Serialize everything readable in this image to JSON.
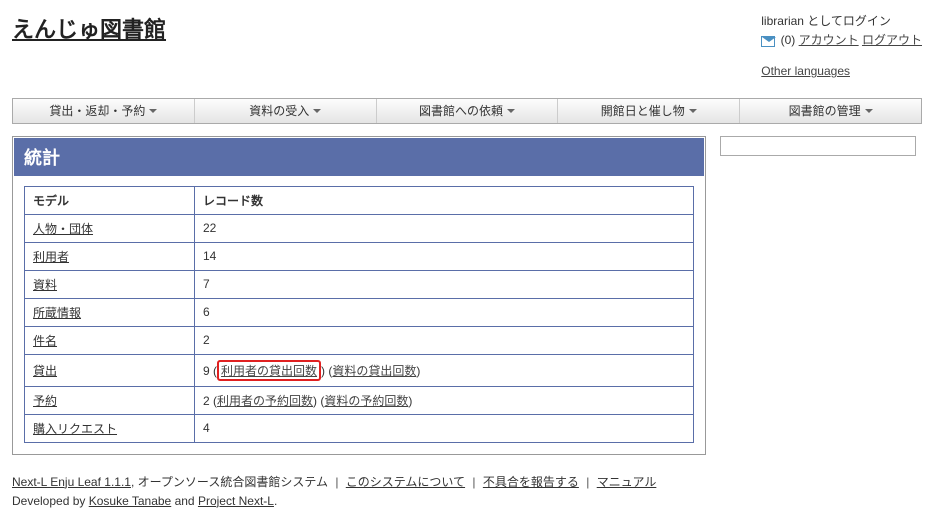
{
  "site": {
    "title": "えんじゅ図書館"
  },
  "login": {
    "status": "librarian としてログイン",
    "count": "(0)",
    "account": "アカウント",
    "logout": "ログアウト",
    "other_languages": "Other languages"
  },
  "menu": {
    "items": [
      {
        "label": "貸出・返却・予約"
      },
      {
        "label": "資料の受入"
      },
      {
        "label": "図書館への依頼"
      },
      {
        "label": "開館日と催し物"
      },
      {
        "label": "図書館の管理"
      }
    ]
  },
  "panel": {
    "title": "統計",
    "headers": {
      "model": "モデル",
      "records": "レコード数"
    },
    "rows": [
      {
        "label": "人物・団体",
        "value": "22",
        "links": []
      },
      {
        "label": "利用者",
        "value": "14",
        "links": []
      },
      {
        "label": "資料",
        "value": "7",
        "links": []
      },
      {
        "label": "所蔵情報",
        "value": "6",
        "links": []
      },
      {
        "label": "件名",
        "value": "2",
        "links": []
      },
      {
        "label": "貸出",
        "value": "9",
        "links": [
          "利用者の貸出回数",
          "資料の貸出回数"
        ],
        "highlight": 0
      },
      {
        "label": "予約",
        "value": "2",
        "links": [
          "利用者の予約回数",
          "資料の予約回数"
        ]
      },
      {
        "label": "購入リクエスト",
        "value": "4",
        "links": []
      }
    ]
  },
  "search": {
    "placeholder": ""
  },
  "footer": {
    "product": "Next-L Enju Leaf 1.1.1",
    "tagline": ", オープンソース統合図書館システム",
    "about": "このシステムについて",
    "report": "不具合を報告する",
    "manual": "マニュアル",
    "developed": "Developed by ",
    "dev1": "Kosuke Tanabe",
    "and": " and ",
    "dev2": "Project Next-L",
    "period": "."
  }
}
